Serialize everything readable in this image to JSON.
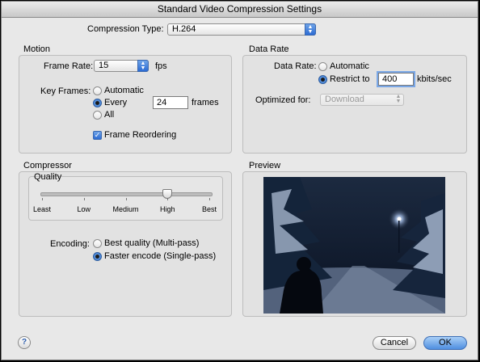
{
  "window": {
    "title": "Standard Video Compression Settings"
  },
  "compression": {
    "label": "Compression Type:",
    "value": "H.264"
  },
  "motion": {
    "title": "Motion",
    "frame_rate_label": "Frame Rate:",
    "frame_rate_value": "15",
    "frame_rate_unit": "fps",
    "key_frames_label": "Key Frames:",
    "kf_automatic": "Automatic",
    "kf_every": "Every",
    "kf_every_value": "24",
    "kf_every_unit": "frames",
    "kf_all": "All",
    "frame_reordering": "Frame Reordering"
  },
  "data_rate": {
    "title": "Data Rate",
    "label": "Data Rate:",
    "automatic": "Automatic",
    "restrict": "Restrict to",
    "value": "400",
    "unit": "kbits/sec",
    "optimized_label": "Optimized for:",
    "optimized_value": "Download"
  },
  "compressor": {
    "title": "Compressor",
    "quality_title": "Quality",
    "quality_level": 0.75,
    "ticks": [
      "Least",
      "Low",
      "Medium",
      "High",
      "Best"
    ],
    "encoding_label": "Encoding:",
    "best_quality": "Best quality (Multi-pass)",
    "faster": "Faster encode (Single-pass)"
  },
  "preview": {
    "title": "Preview"
  },
  "buttons": {
    "help": "?",
    "cancel": "Cancel",
    "ok": "OK"
  },
  "colors": {
    "accent": "#2c6bd3"
  }
}
